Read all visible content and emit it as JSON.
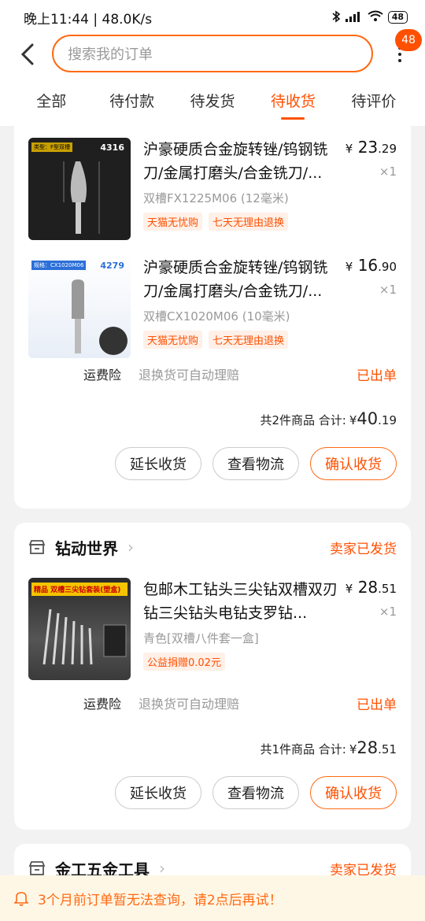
{
  "status_bar": {
    "time_speed": "晚上11:44 | 48.0K/s",
    "battery": "48"
  },
  "search": {
    "placeholder": "搜索我的订单"
  },
  "more_badge": "48",
  "tabs": [
    {
      "label": "全部",
      "active": false
    },
    {
      "label": "待付款",
      "active": false
    },
    {
      "label": "待发货",
      "active": false
    },
    {
      "label": "待收货",
      "active": true
    },
    {
      "label": "待评价",
      "active": false
    }
  ],
  "orders": [
    {
      "items": [
        {
          "thumb_code": "4316",
          "thumb_tag": "类型：F型双槽",
          "title": "沪豪硬质合金旋转锉/钨钢铣刀/金属打磨头/合金铣刀/...",
          "spec": "双槽FX1225M06 (12毫米)",
          "tags": [
            "天猫无忧购",
            "七天无理由退换"
          ],
          "price_int": "23",
          "price_dec": ".29",
          "qty": "×1"
        },
        {
          "thumb_code": "4279",
          "thumb_tag": "规格：CX1020M06",
          "title": "沪豪硬质合金旋转锉/钨钢铣刀/金属打磨头/合金铣刀/...",
          "spec": "双槽CX1020M06 (10毫米)",
          "tags": [
            "天猫无忧购",
            "七天无理由退换"
          ],
          "price_int": "16",
          "price_dec": ".90",
          "qty": "×1"
        }
      ],
      "insurance_label": "运费险",
      "insurance_text": "退换货可自动理赔",
      "insurance_status": "已出单",
      "total_count": "共2件商品",
      "total_label": "合计:",
      "total_int": "40",
      "total_dec": ".19",
      "buttons": [
        "延长收货",
        "查看物流",
        "确认收货"
      ]
    },
    {
      "shop_name": "钻动世界",
      "shop_status": "卖家已发货",
      "items": [
        {
          "thumb_title": "精品 双槽三尖钻套装(塑盒)",
          "title": "包邮木工钻头三尖钻双槽双刃钻三尖钻头电钻支罗钻...",
          "spec": "青色[双槽八件套一盒]",
          "tags": [
            "公益捐赠0.02元"
          ],
          "price_int": "28",
          "price_dec": ".51",
          "qty": "×1"
        }
      ],
      "insurance_label": "运费险",
      "insurance_text": "退换货可自动理赔",
      "insurance_status": "已出单",
      "total_count": "共1件商品",
      "total_label": "合计:",
      "total_int": "28",
      "total_dec": ".51",
      "buttons": [
        "延长收货",
        "查看物流",
        "确认收货"
      ]
    },
    {
      "shop_name": "金工五金工具",
      "shop_status": "卖家已发货"
    }
  ],
  "currency": "¥",
  "toast": "3个月前订单暂无法查询，请2点后再试！",
  "colors": {
    "accent": "#ff5000",
    "background": "#f2f2f2"
  }
}
